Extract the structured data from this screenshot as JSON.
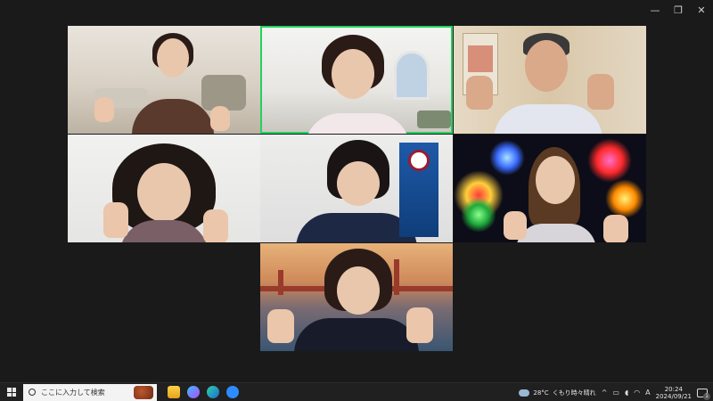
{
  "window": {
    "controls": {
      "minimize": "—",
      "restore": "❐",
      "close": "✕"
    }
  },
  "gallery": {
    "active_speaker_color": "#23d160",
    "tiles": [
      {
        "id": "participant-1",
        "background": "home interior"
      },
      {
        "id": "participant-2",
        "background": "white living room",
        "active": true
      },
      {
        "id": "participant-3",
        "background": "japanese room"
      },
      {
        "id": "participant-4",
        "background": "plain light"
      },
      {
        "id": "participant-5",
        "background": "office with banner"
      },
      {
        "id": "participant-6",
        "background": "fireworks"
      },
      {
        "id": "participant-7",
        "background": "golden gate bridge"
      }
    ]
  },
  "taskbar": {
    "search_placeholder": "ここに入力して検索",
    "pinned_apps": [
      "file-explorer-icon",
      "copilot-icon",
      "edge-icon",
      "zoom-icon"
    ],
    "weather": {
      "temp": "28°C",
      "desc": "くもり時々晴れ"
    },
    "tray": {
      "chevron": "^",
      "ime": "A"
    },
    "clock": {
      "time": "20:24",
      "date": "2024/09/21"
    },
    "notification_count": "1"
  }
}
